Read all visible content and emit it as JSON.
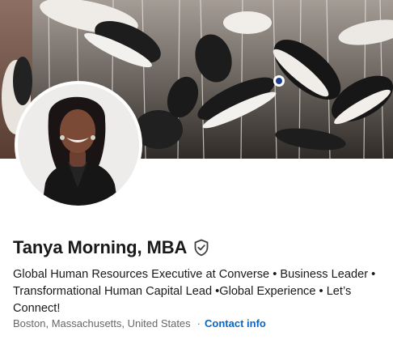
{
  "profile": {
    "name": "Tanya Morning, MBA",
    "headline_lines": [
      "Global Human Resources Executive at Converse • Business Leader •",
      "Transformational Human Capital Lead •Global Experience • Let’s",
      "Connect!"
    ],
    "location": "Boston, Massachusetts, United States",
    "separator": "·",
    "contact_label": "Contact info"
  },
  "icons": {
    "verification": "verified-shield-icon"
  },
  "colors": {
    "link": "#0a66c2",
    "text_primary": "#191919",
    "text_secondary": "#666666"
  }
}
